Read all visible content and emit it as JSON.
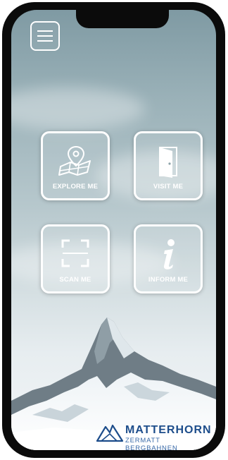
{
  "menu": {
    "icon": "hamburger-menu-icon"
  },
  "tiles": [
    {
      "label": "EXPLORE ME",
      "icon": "map-pin-icon"
    },
    {
      "label": "VISIT ME",
      "icon": "door-icon"
    },
    {
      "label": "SCAN ME",
      "icon": "scan-frame-icon"
    },
    {
      "label": "INFORM ME",
      "icon": "info-icon"
    }
  ],
  "brand": {
    "name": "MATTERHORN",
    "subtitle": "ZERMATT BERGBAHNEN",
    "color": "#1d4d8b"
  }
}
